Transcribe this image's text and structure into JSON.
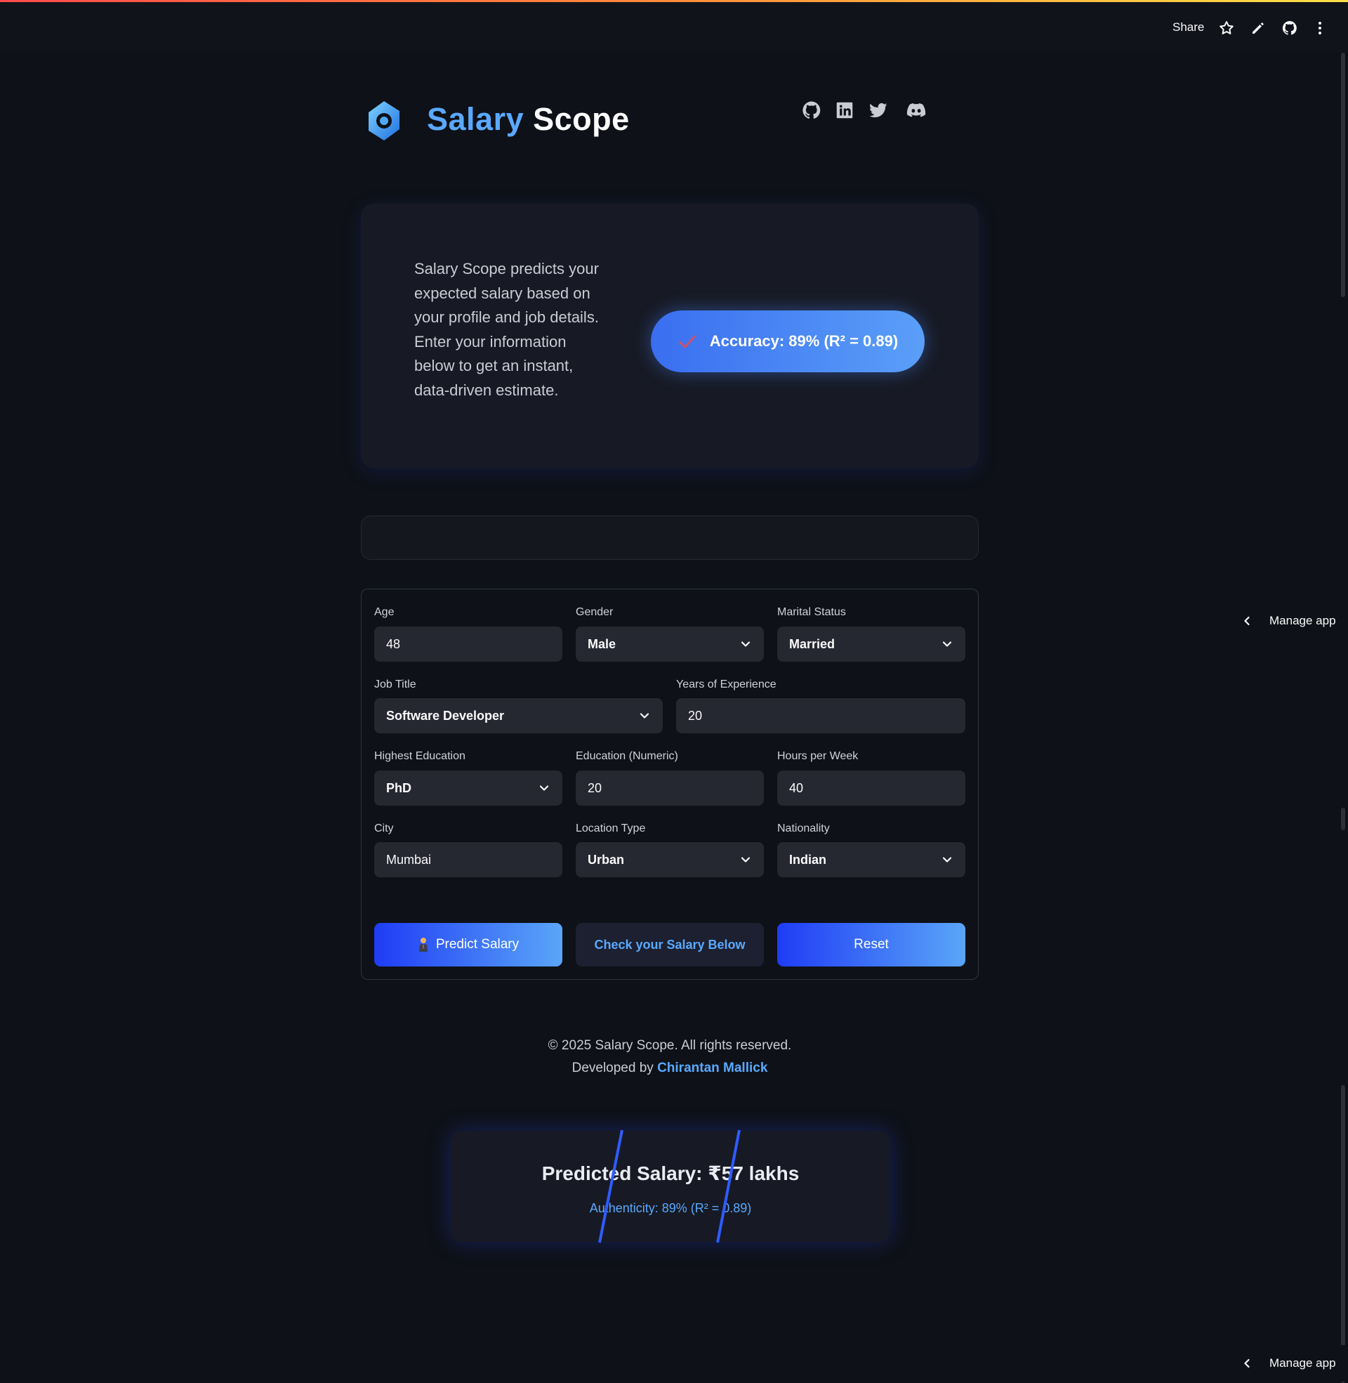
{
  "topbar": {
    "share_label": "Share",
    "icons": [
      "star-icon",
      "pencil-icon",
      "github-icon",
      "more-vertical-icon"
    ]
  },
  "header": {
    "title_part1": "Salary",
    "title_part2": "Scope",
    "social_icons": [
      "github-icon",
      "linkedin-icon",
      "twitter-icon",
      "discord-icon"
    ]
  },
  "intro": {
    "description": "Salary Scope predicts your expected salary based on your profile and job details. Enter your information below to get an instant, data-driven estimate.",
    "accuracy_label": "Accuracy: 89% (R² = 0.89)"
  },
  "form": {
    "age": {
      "label": "Age",
      "value": "48"
    },
    "gender": {
      "label": "Gender",
      "value": "Male"
    },
    "marital_status": {
      "label": "Marital Status",
      "value": "Married"
    },
    "job_title": {
      "label": "Job Title",
      "value": "Software Developer"
    },
    "experience": {
      "label": "Years of Experience",
      "value": "20"
    },
    "education": {
      "label": "Highest Education",
      "value": "PhD"
    },
    "education_numeric": {
      "label": "Education (Numeric)",
      "value": "20"
    },
    "hours": {
      "label": "Hours per Week",
      "value": "40"
    },
    "city": {
      "label": "City",
      "value": "Mumbai"
    },
    "location_type": {
      "label": "Location Type",
      "value": "Urban"
    },
    "nationality": {
      "label": "Nationality",
      "value": "Indian"
    }
  },
  "buttons": {
    "predict": "Predict Salary",
    "check": "Check your Salary Below",
    "reset": "Reset"
  },
  "footer": {
    "copyright": "© 2025 Salary Scope. All rights reserved.",
    "developed_by": "Developed by",
    "developer": "Chirantan Mallick"
  },
  "result": {
    "title": "Predicted Salary: ₹57 lakhs",
    "subtitle": "Authenticity: 89% (R² = 0.89)"
  },
  "manage_app": {
    "label": "Manage app"
  },
  "colors": {
    "background": "#0e1117",
    "accent_blue": "#5aa9ff",
    "button_blue": "#1f3cf5",
    "card": "#171a24"
  }
}
